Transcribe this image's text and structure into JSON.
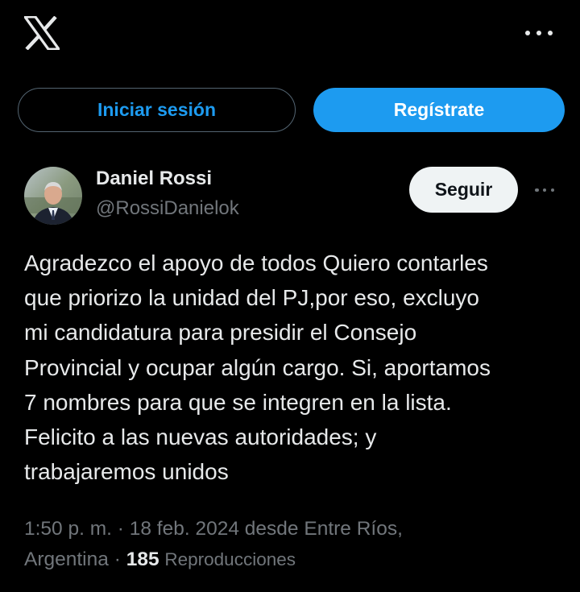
{
  "header": {
    "logo_icon": "x-logo-icon",
    "more_icon": "more-horizontal-icon"
  },
  "auth": {
    "login_label": "Iniciar sesión",
    "signup_label": "Regístrate"
  },
  "author": {
    "display_name": "Daniel Rossi",
    "handle": "@RossiDanielok",
    "avatar_icon": "avatar-photo",
    "follow_label": "Seguir",
    "more_icon": "more-horizontal-icon"
  },
  "tweet": {
    "text_lines": [
      "Agradezco el apoyo de todos Quiero contarles",
      "que priorizo la unidad del PJ,por eso, excluyo",
      "mi candidatura para presidir el Consejo",
      "Provincial y ocupar algún cargo. Si, aportamos",
      "7 nombres para que se integren en la lista.",
      "Felicito a las nuevas autoridades; y",
      "trabajaremos unidos"
    ]
  },
  "meta": {
    "time": "1:50 p. m.",
    "separator": "·",
    "date": "18 feb. 2024",
    "location_line1": "desde Entre Ríos,",
    "location_line2": "Argentina",
    "views_count": "185",
    "views_label": "Reproducciones"
  },
  "colors": {
    "background": "#000000",
    "accent": "#1d9bf0",
    "text_primary": "#e7e9ea",
    "text_secondary": "#71767b",
    "follow_bg": "#eff3f4"
  }
}
